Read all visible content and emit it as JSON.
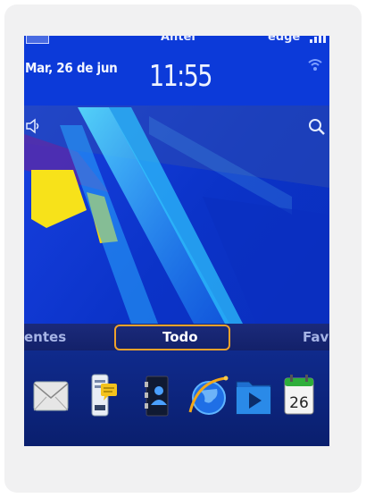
{
  "status_bar": {
    "carrier": "Antel",
    "network": "edge"
  },
  "lockscreen": {
    "date": "Mar, 26 de jun",
    "time": "11:55"
  },
  "tabs": {
    "left_label": "entes",
    "center_label": "Todo",
    "right_label": "Favo"
  },
  "dock": {
    "calendar_day": "26",
    "icons": [
      "envelope-icon",
      "document-note-icon",
      "contacts-icon",
      "browser-globe-icon",
      "media-folder-icon",
      "calendar-icon"
    ]
  },
  "colors": {
    "highlight": "#f0a22b",
    "wallpaper_blue": "#0a34d0",
    "wallpaper_cyan": "#2ec7ff",
    "wallpaper_yellow": "#f7e21a"
  }
}
